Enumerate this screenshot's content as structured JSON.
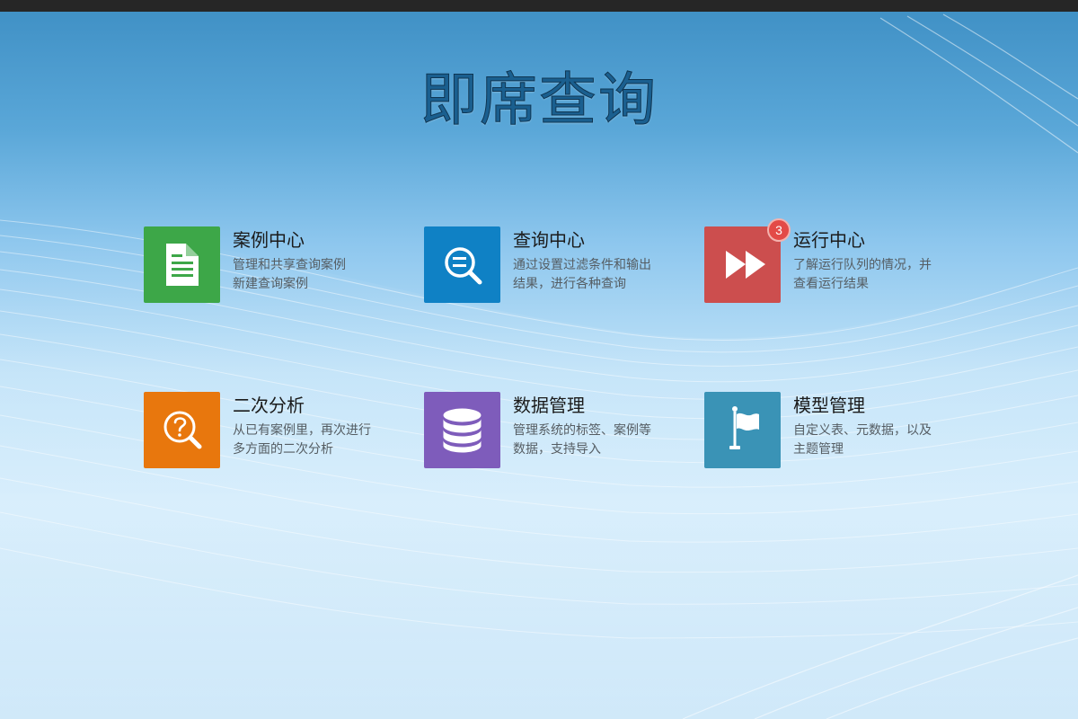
{
  "page": {
    "title": "即席查询"
  },
  "colors": {
    "topbar": "#262626",
    "case_center": "#3da748",
    "query_center": "#0f81c5",
    "run_center": "#cc4e4e",
    "analysis": "#e8770d",
    "data_mgmt": "#7e5cbb",
    "model_mgmt": "#3a93b6"
  },
  "cards": [
    {
      "title": "案例中心",
      "desc_line1": "管理和共享查询案例",
      "desc_line2": "新建查询案例",
      "icon": "document-icon"
    },
    {
      "title": "查询中心",
      "desc_line1": "通过设置过滤条件和输出",
      "desc_line2": "结果，进行各种查询",
      "icon": "search-list-icon"
    },
    {
      "title": "运行中心",
      "desc_line1": "了解运行队列的情况，并",
      "desc_line2": "查看运行结果",
      "icon": "fast-forward-icon",
      "badge": "3"
    },
    {
      "title": "二次分析",
      "desc_line1": "从已有案例里，再次进行",
      "desc_line2": "多方面的二次分析",
      "icon": "search-question-icon"
    },
    {
      "title": "数据管理",
      "desc_line1": "管理系统的标签、案例等",
      "desc_line2": "数据，支持导入",
      "icon": "database-icon"
    },
    {
      "title": "模型管理",
      "desc_line1": "自定义表、元数据，以及",
      "desc_line2": "主题管理",
      "icon": "flag-icon"
    }
  ]
}
